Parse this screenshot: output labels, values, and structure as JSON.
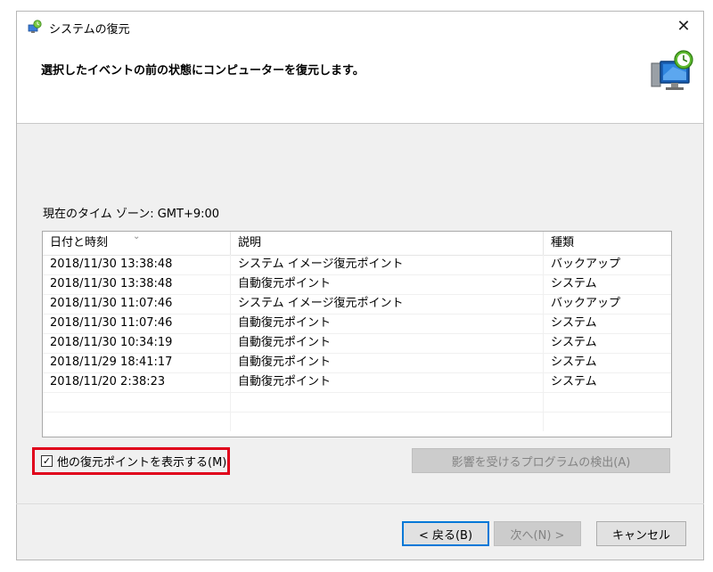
{
  "window": {
    "title": "システムの復元",
    "close_glyph": "✕"
  },
  "header": {
    "instruction": "選択したイベントの前の状態にコンピューターを復元します。"
  },
  "timezone_label": "現在のタイム ゾーン: GMT+9:00",
  "list": {
    "columns": [
      "日付と時刻",
      "説明",
      "種類"
    ],
    "sort_glyph": "⌄",
    "rows": [
      [
        "2018/11/30 13:38:48",
        "システム イメージ復元ポイント",
        "バックアップ"
      ],
      [
        "2018/11/30 13:38:48",
        "自動復元ポイント",
        "システム"
      ],
      [
        "2018/11/30 11:07:46",
        "システム イメージ復元ポイント",
        "バックアップ"
      ],
      [
        "2018/11/30 11:07:46",
        "自動復元ポイント",
        "システム"
      ],
      [
        "2018/11/30 10:34:19",
        "自動復元ポイント",
        "システム"
      ],
      [
        "2018/11/29 18:41:17",
        "自動復元ポイント",
        "システム"
      ],
      [
        "2018/11/20 2:38:23",
        "自動復元ポイント",
        "システム"
      ]
    ]
  },
  "show_more": {
    "label": "他の復元ポイントを表示する(M)",
    "checked": true,
    "check_glyph": "✓"
  },
  "buttons": {
    "scan": "影響を受けるプログラムの検出(A)",
    "back": "< 戻る(B)",
    "next": "次へ(N) >",
    "cancel": "キャンセル"
  },
  "colors": {
    "highlight": "#e0001b",
    "accent": "#0078d7"
  },
  "icons": {
    "title": "system-restore-icon",
    "header": "computer-restore-icon"
  }
}
